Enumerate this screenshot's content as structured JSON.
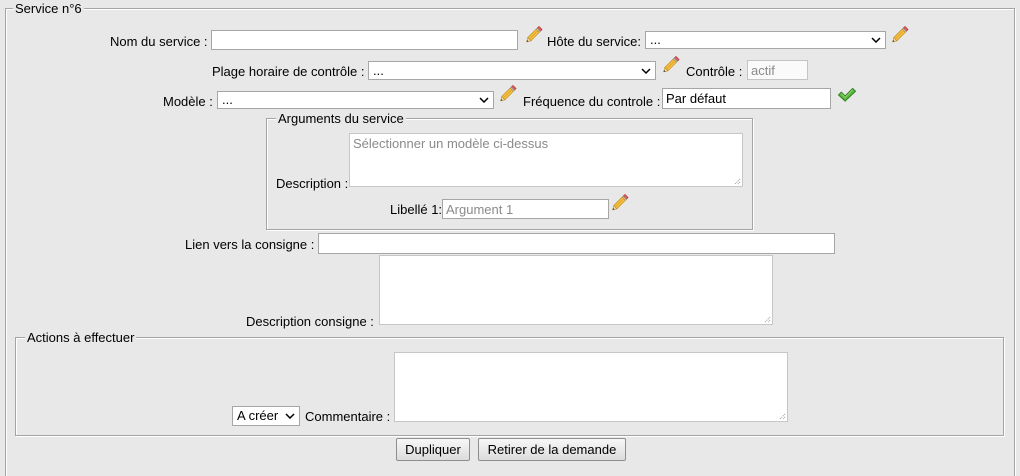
{
  "service": {
    "legend": "Service n°6",
    "nom": {
      "label": "Nom du service :",
      "value": ""
    },
    "hote": {
      "label": "Hôte du service:",
      "selected": "..."
    },
    "plage": {
      "label": "Plage horaire de contrôle :",
      "selected": "..."
    },
    "controle": {
      "label": "Contrôle :",
      "value": "actif"
    },
    "modele": {
      "label": "Modèle :",
      "selected": "..."
    },
    "frequence": {
      "label": "Fréquence du controle :",
      "value": "Par défaut"
    },
    "arguments": {
      "legend": "Arguments du service",
      "description": {
        "label": "Description :",
        "value": "",
        "placeholder": "Sélectionner un modèle ci-dessus"
      },
      "libelle_1": {
        "label": "Libellé 1:",
        "placeholder": "Argument 1"
      }
    },
    "lien_consigne": {
      "label": "Lien vers la consigne :",
      "value": ""
    },
    "description_consigne": {
      "label": "Description consigne :",
      "value": ""
    }
  },
  "actions": {
    "legend": "Actions à effectuer",
    "etat": {
      "selected": "A créer"
    },
    "commentaire": {
      "label": "Commentaire :",
      "value": ""
    }
  },
  "buttons": {
    "dupliquer": "Dupliquer",
    "retirer": "Retirer de la demande"
  },
  "icons": {
    "edit": "pencil-icon",
    "validate": "checkmark-icon",
    "dropdown": "chevron-down-icon",
    "resize": "resize-grip-icon"
  },
  "colors": {
    "page_background": "#e8e8e8",
    "validate_green": "#5cb83c",
    "disabled_text": "#8a8a8a",
    "placeholder_text": "#8a8a8a"
  }
}
